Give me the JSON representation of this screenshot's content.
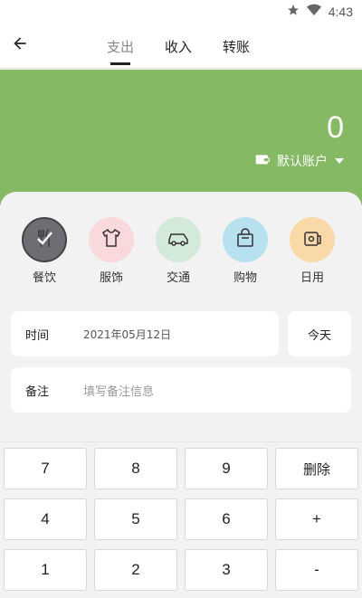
{
  "status_bar": {
    "time": "4:43",
    "icons": [
      "star-icon",
      "wifi-icon"
    ]
  },
  "app_bar": {
    "back_icon": "back-arrow-icon",
    "tabs": [
      {
        "label": "支出",
        "active": true
      },
      {
        "label": "收入",
        "active": false
      },
      {
        "label": "转账",
        "active": false
      }
    ]
  },
  "header": {
    "amount": "0",
    "account_label": "默认账户",
    "account_icon": "wallet-icon",
    "color": "#85b964"
  },
  "categories": [
    {
      "label": "餐饮",
      "icon": "fork-knife-icon",
      "selected": true,
      "color": "#6d6d74"
    },
    {
      "label": "服饰",
      "icon": "shirt-icon",
      "selected": false,
      "color": "#f9d9dc"
    },
    {
      "label": "交通",
      "icon": "car-icon",
      "selected": false,
      "color": "#d3eadb"
    },
    {
      "label": "购物",
      "icon": "shopping-bag-icon",
      "selected": false,
      "color": "#b8e1ef"
    },
    {
      "label": "日用",
      "icon": "toilet-paper-icon",
      "selected": false,
      "color": "#f9d9a8"
    }
  ],
  "form": {
    "time_label": "时间",
    "time_value": "2021年05月12日",
    "today_button": "今天",
    "note_label": "备注",
    "note_placeholder": "填写备注信息"
  },
  "keypad": {
    "keys": [
      "7",
      "8",
      "9",
      "删除",
      "4",
      "5",
      "6",
      "+",
      "1",
      "2",
      "3",
      "-"
    ]
  }
}
